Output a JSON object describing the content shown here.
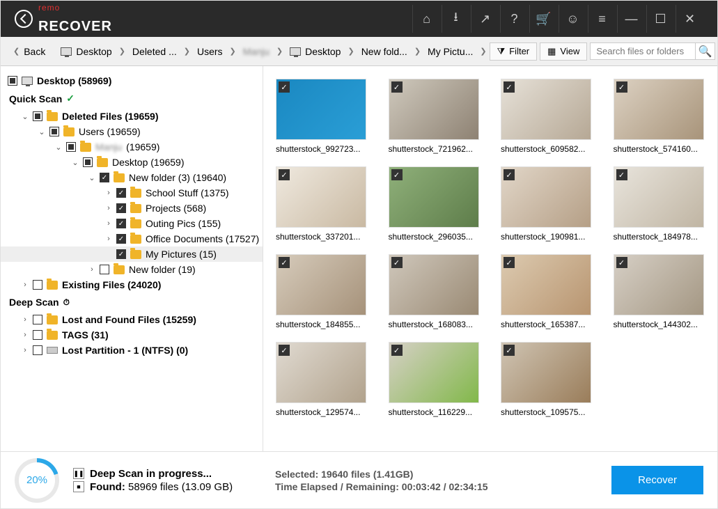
{
  "titlebar": {
    "brand_pre": "remo",
    "brand_main": "RECOVER"
  },
  "toolbar": {
    "back": "Back",
    "breadcrumb": [
      "Desktop",
      "Deleted ...",
      "Users",
      "Manju",
      "Desktop",
      "New fold...",
      "My Pictu..."
    ],
    "filter": "Filter",
    "view": "View",
    "search_placeholder": "Search files or folders"
  },
  "tree": {
    "root": "Desktop (58969)",
    "quick_scan": "Quick Scan",
    "deleted_files": "Deleted Files (19659)",
    "users": "Users (19659)",
    "manju": "(19659)",
    "desktop2": "Desktop (19659)",
    "new_folder3": "New folder (3) (19640)",
    "school_stuff": "School Stuff (1375)",
    "projects": "Projects (568)",
    "outing_pics": "Outing Pics (155)",
    "office_docs": "Office Documents (17527)",
    "my_pictures": "My Pictures (15)",
    "new_folder19": "New folder (19)",
    "existing_files": "Existing Files (24020)",
    "deep_scan": "Deep Scan",
    "lost_found": "Lost and Found Files (15259)",
    "tags": "TAGS (31)",
    "lost_partition": "Lost Partition - 1 (NTFS) (0)"
  },
  "thumbs": [
    "shutterstock_992723...",
    "shutterstock_721962...",
    "shutterstock_609582...",
    "shutterstock_574160...",
    "shutterstock_337201...",
    "shutterstock_296035...",
    "shutterstock_190981...",
    "shutterstock_184978...",
    "shutterstock_184855...",
    "shutterstock_168083...",
    "shutterstock_165387...",
    "shutterstock_144302...",
    "shutterstock_129574...",
    "shutterstock_116229...",
    "shutterstock_109575..."
  ],
  "thumb_colors": [
    [
      "#1a88c1",
      "#2a9ed6"
    ],
    [
      "#cfc9bd",
      "#8e8273"
    ],
    [
      "#e6e1d8",
      "#b6a895"
    ],
    [
      "#dcd1c2",
      "#a8947a"
    ],
    [
      "#efe9df",
      "#c9b9a2"
    ],
    [
      "#8fb07a",
      "#5e7d4a"
    ],
    [
      "#e1d6c8",
      "#b59f86"
    ],
    [
      "#e8e4dc",
      "#c0b5a3"
    ],
    [
      "#d6cbbb",
      "#a6927a"
    ],
    [
      "#cfc7bb",
      "#9a8a74"
    ],
    [
      "#dccab0",
      "#b89570"
    ],
    [
      "#d6cfc5",
      "#a49783"
    ],
    [
      "#e0dad1",
      "#b1a28c"
    ],
    [
      "#d6d0c6",
      "#82b84a"
    ],
    [
      "#cfc4b3",
      "#9a7d5a"
    ]
  ],
  "footer": {
    "percent": "20%",
    "scan_line": "Deep Scan in progress...",
    "found_label": "Found:",
    "found_value": "58969 files (13.09 GB)",
    "selected": "Selected: 19640 files (1.41GB)",
    "time": "Time Elapsed / Remaining: 00:03:42 / 02:34:15",
    "recover": "Recover"
  }
}
